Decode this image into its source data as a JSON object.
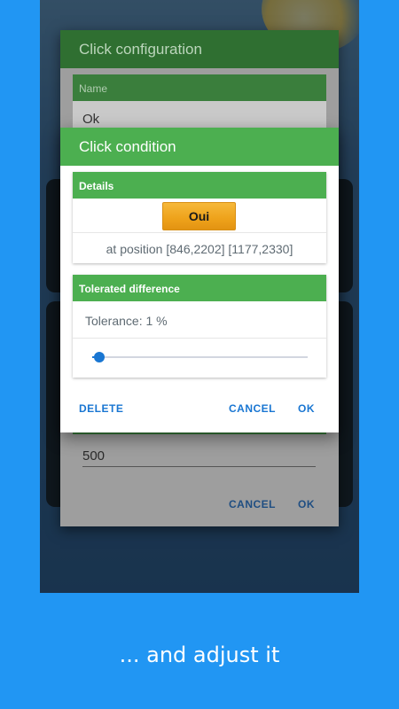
{
  "background_color": "#2196F3",
  "accent_color": "#4CAF50",
  "button_color": "#1976D2",
  "back_dialog": {
    "title": "Click configuration",
    "name_header": "Name",
    "name_value": "Ok",
    "delay_value": "500",
    "cancel_label": "CANCEL",
    "ok_label": "OK"
  },
  "click_condition": {
    "title": "Click condition",
    "details_header": "Details",
    "condition_image_text": "Oui",
    "position_text": "at position [846,2202] [1177,2330]",
    "tolerance_header": "Tolerated difference",
    "tolerance_text": "Tolerance: 1 %",
    "tolerance_value": 1,
    "tolerance_max": 100,
    "delete_label": "DELETE",
    "cancel_label": "CANCEL",
    "ok_label": "OK"
  },
  "caption": "... and adjust it"
}
